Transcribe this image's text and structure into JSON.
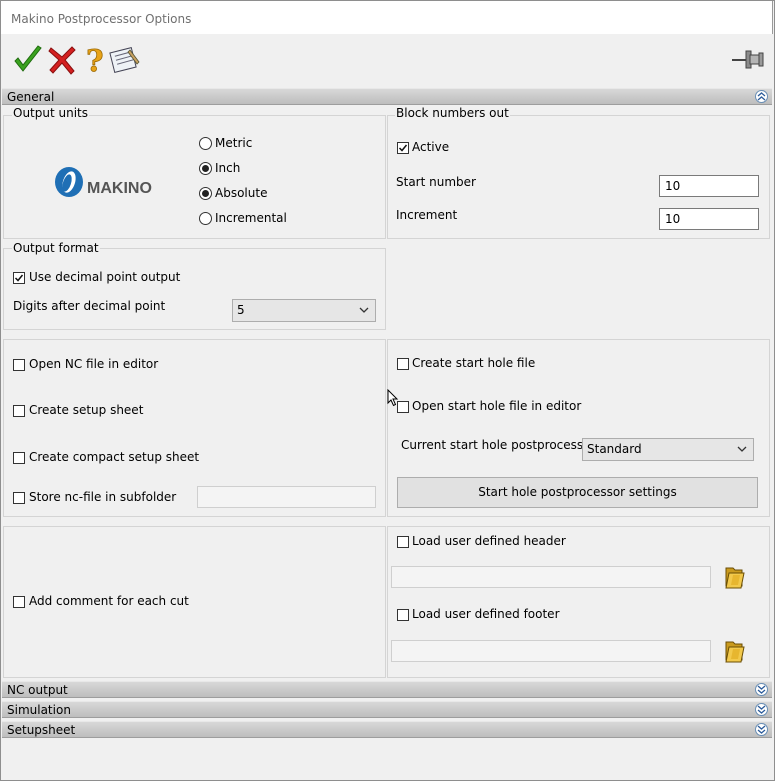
{
  "window": {
    "title": "Makino Postprocessor Options"
  },
  "toolbar": {
    "ok": "check-icon",
    "cancel": "x-icon",
    "help": "question-icon",
    "notes": "notepad-icon",
    "pin": "pin-icon"
  },
  "sections": {
    "general": "General",
    "nc_output": "NC output",
    "simulation": "Simulation",
    "setupsheet": "Setupsheet"
  },
  "output_units": {
    "label": "Output units",
    "logo_text": "MAKINO",
    "radios": [
      {
        "label": "Metric",
        "checked": false
      },
      {
        "label": "Inch",
        "checked": true
      },
      {
        "label": "Absolute",
        "checked": true
      },
      {
        "label": "Incremental",
        "checked": false
      }
    ]
  },
  "block_numbers": {
    "label": "Block numbers out",
    "active_label": "Active",
    "active_checked": true,
    "start_label": "Start number",
    "start_value": "10",
    "increment_label": "Increment",
    "increment_value": "10"
  },
  "output_format": {
    "label": "Output format",
    "decimal_label": "Use decimal point output",
    "decimal_checked": true,
    "digits_label": "Digits after decimal point",
    "digits_value": "5"
  },
  "files": {
    "open_nc": "Open NC file in editor",
    "setup_sheet": "Create setup sheet",
    "compact_setup": "Create compact setup sheet",
    "store_subfolder": "Store nc-file in subfolder",
    "subfolder_value": ""
  },
  "start_hole": {
    "create": "Create start hole file",
    "open": "Open start hole file in editor",
    "current_label": "Current start hole postprocessor",
    "current_value": "Standard",
    "settings_button": "Start hole postprocessor settings"
  },
  "comments": {
    "add_comment": "Add comment for each cut",
    "header_label": "Load user defined header",
    "header_value": "",
    "footer_label": "Load user defined footer",
    "footer_value": ""
  },
  "colors": {
    "logo_blue": "#1f6fb5",
    "check_green": "#3aa21f",
    "cancel_red": "#d42020",
    "help_orange": "#e8a317"
  }
}
